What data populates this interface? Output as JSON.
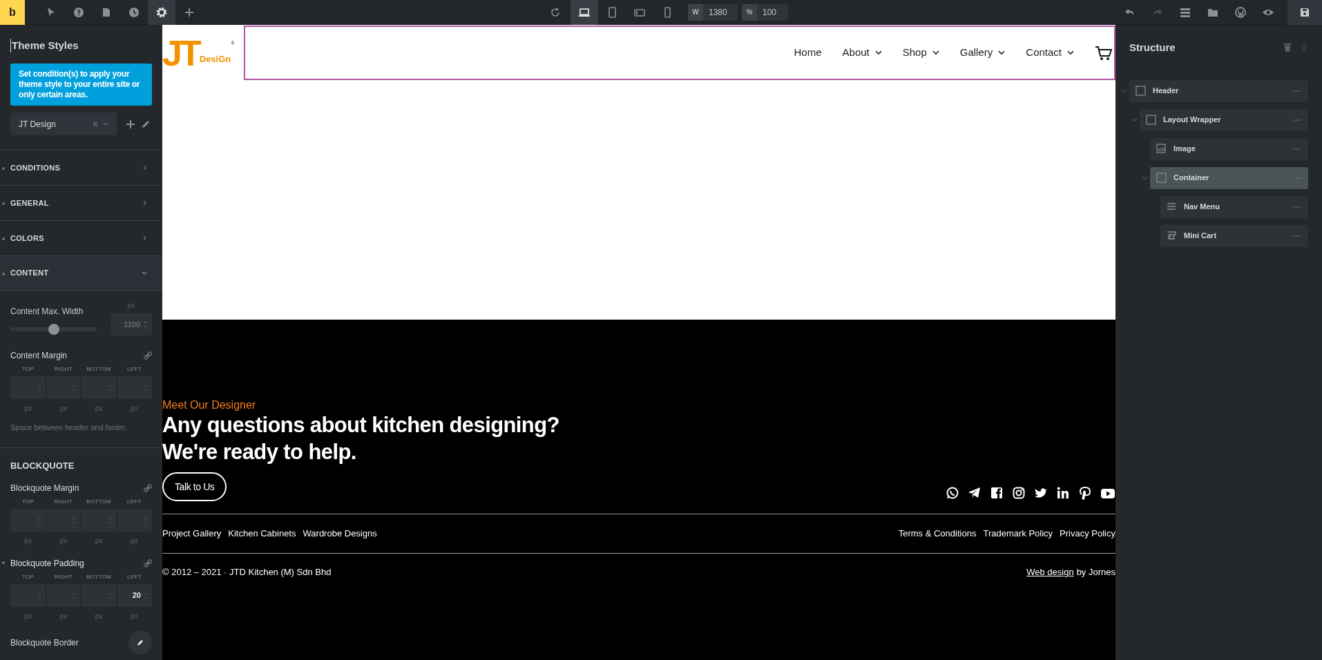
{
  "toolbar": {
    "logo": "b",
    "tools": [
      {
        "selected": false
      },
      {
        "selected": false
      },
      {
        "selected": false
      },
      {
        "selected": false
      },
      {
        "selected": true
      },
      {
        "selected": false
      }
    ],
    "devices": [
      {
        "selected": true
      },
      {
        "selected": false
      },
      {
        "selected": false
      },
      {
        "selected": false
      }
    ],
    "width": {
      "label": "W",
      "value": "1380"
    },
    "zoom": {
      "label": "%",
      "value": "100"
    }
  },
  "left_panel": {
    "title": "Theme Styles",
    "notice": "Set condition(s) to apply your theme style to your entire site or only certain areas.",
    "style_select": {
      "value": "JT Design"
    },
    "sections": [
      {
        "label": "CONDITIONS",
        "expanded": false
      },
      {
        "label": "GENERAL",
        "expanded": false
      },
      {
        "label": "COLORS",
        "expanded": false
      },
      {
        "label": "CONTENT",
        "expanded": true
      }
    ],
    "content": {
      "max_width": {
        "label": "Content Max. Width",
        "unit": "px",
        "value": "1100",
        "level": 0.5
      },
      "margin": {
        "label": "Content Margin",
        "modified": false,
        "sides": [
          {
            "label": "TOP",
            "unit": "px"
          },
          {
            "label": "RIGHT",
            "unit": "px"
          },
          {
            "label": "BOTTOM",
            "unit": "px"
          },
          {
            "label": "LEFT",
            "unit": "px"
          }
        ]
      },
      "hint": "Space between header and footer."
    },
    "blockquote": {
      "heading": "BLOCKQUOTE",
      "controls": [
        {
          "label": "Blockquote Margin",
          "modified": false,
          "sides": [
            {
              "label": "TOP",
              "unit": "px"
            },
            {
              "label": "RIGHT",
              "unit": "px"
            },
            {
              "label": "BOTTOM",
              "unit": "px"
            },
            {
              "label": "LEFT",
              "unit": "px"
            }
          ]
        },
        {
          "label": "Blockquote Padding",
          "modified": true,
          "sides": [
            {
              "label": "TOP",
              "unit": "px"
            },
            {
              "label": "RIGHT",
              "unit": "px"
            },
            {
              "label": "BOTTOM",
              "unit": "px"
            },
            {
              "label": "LEFT",
              "unit": "px",
              "value": "20"
            }
          ]
        }
      ],
      "border_label": "Blockquote Border"
    }
  },
  "preview": {
    "header": {
      "logo": {
        "letters": "JT",
        "word": "DesiGn",
        "mark": "®"
      },
      "nav": [
        {
          "label": "Home",
          "dropdown": false
        },
        {
          "label": "About",
          "dropdown": true
        },
        {
          "label": "Shop",
          "dropdown": true
        },
        {
          "label": "Gallery",
          "dropdown": true
        },
        {
          "label": "Contact",
          "dropdown": true
        }
      ]
    },
    "footer": {
      "eyebrow": "Meet Our Designer",
      "headline": [
        "Any questions about kitchen designing?",
        "We're ready to help."
      ],
      "button": "Talk to Us",
      "left_links": [
        "Project Gallery",
        "Kitchen Cabinets",
        "Wardrobe Designs"
      ],
      "right_links": [
        "Terms & Conditions",
        "Trademark Policy",
        "Privacy Policy"
      ],
      "copyright": "© 2012 – 2021 · JTD Kitchen (M) Sdn Bhd",
      "credit_link": "Web design",
      "credit_rest": "by Jornes"
    }
  },
  "structure": {
    "title": "Structure",
    "tree": [
      {
        "label": "Header",
        "kind": "block",
        "selected": false,
        "expanded": true,
        "children": [
          {
            "label": "Layout Wrapper",
            "kind": "block",
            "selected": false,
            "expanded": true,
            "children": [
              {
                "label": "Image",
                "kind": "image",
                "selected": false
              },
              {
                "label": "Container",
                "kind": "block",
                "selected": true,
                "expanded": true,
                "children": [
                  {
                    "label": "Nav Menu",
                    "kind": "menu",
                    "selected": false
                  },
                  {
                    "label": "Mini Cart",
                    "kind": "cart",
                    "selected": false
                  }
                ]
              }
            ]
          }
        ]
      }
    ]
  }
}
